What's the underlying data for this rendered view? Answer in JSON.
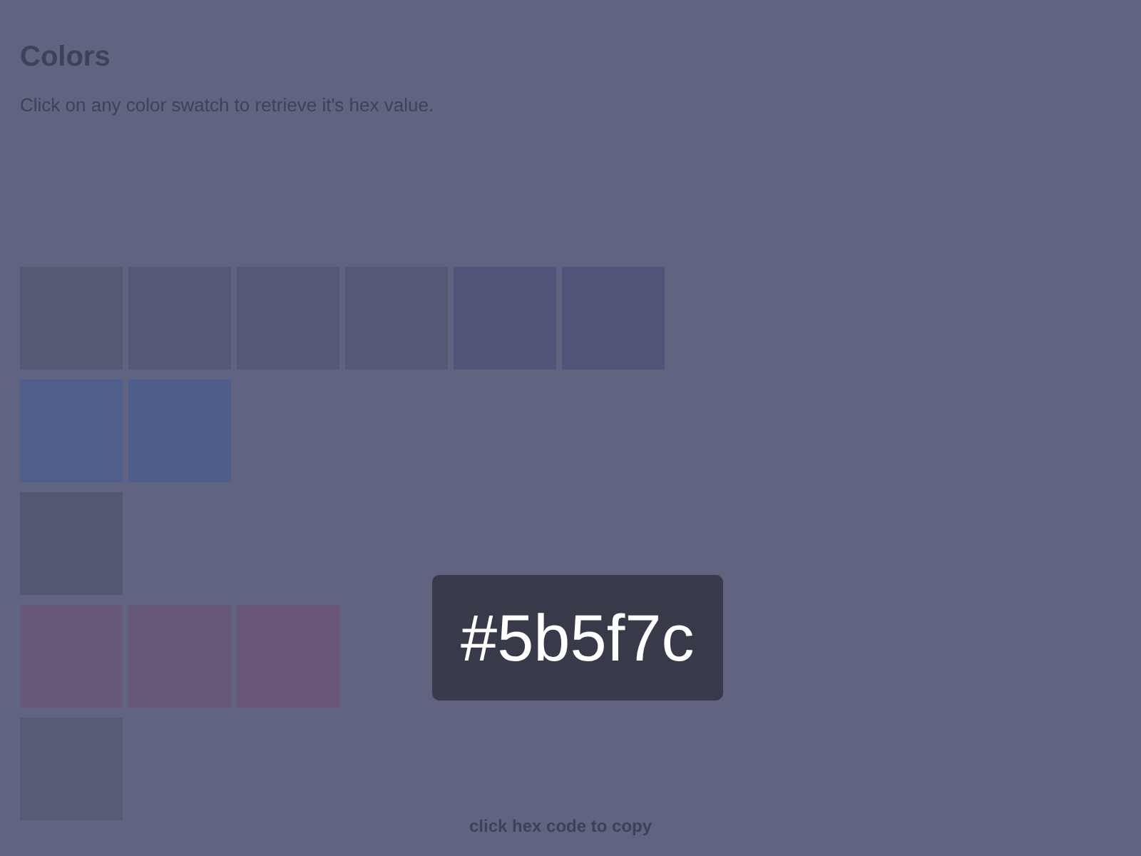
{
  "page": {
    "title": "Colors",
    "instructions": "Click on any color swatch to retrieve it's hex value."
  },
  "swatch_rows": [
    {
      "swatches": [
        {
          "color": "#565a75"
        },
        {
          "color": "#565a76"
        },
        {
          "color": "#565975"
        },
        {
          "color": "#565975"
        },
        {
          "color": "#515579"
        },
        {
          "color": "#505479"
        }
      ]
    },
    {
      "swatches": [
        {
          "color": "#505f8b"
        },
        {
          "color": "#4f5e8b"
        }
      ]
    },
    {
      "swatches": [
        {
          "color": "#535771"
        }
      ]
    },
    {
      "swatches": [
        {
          "color": "#665979"
        },
        {
          "color": "#675778"
        },
        {
          "color": "#685778"
        }
      ]
    },
    {
      "swatches": [
        {
          "color": "#575c76"
        }
      ]
    }
  ],
  "popup": {
    "hex_code": "#5b5f7c",
    "hint": "click hex code to copy"
  }
}
